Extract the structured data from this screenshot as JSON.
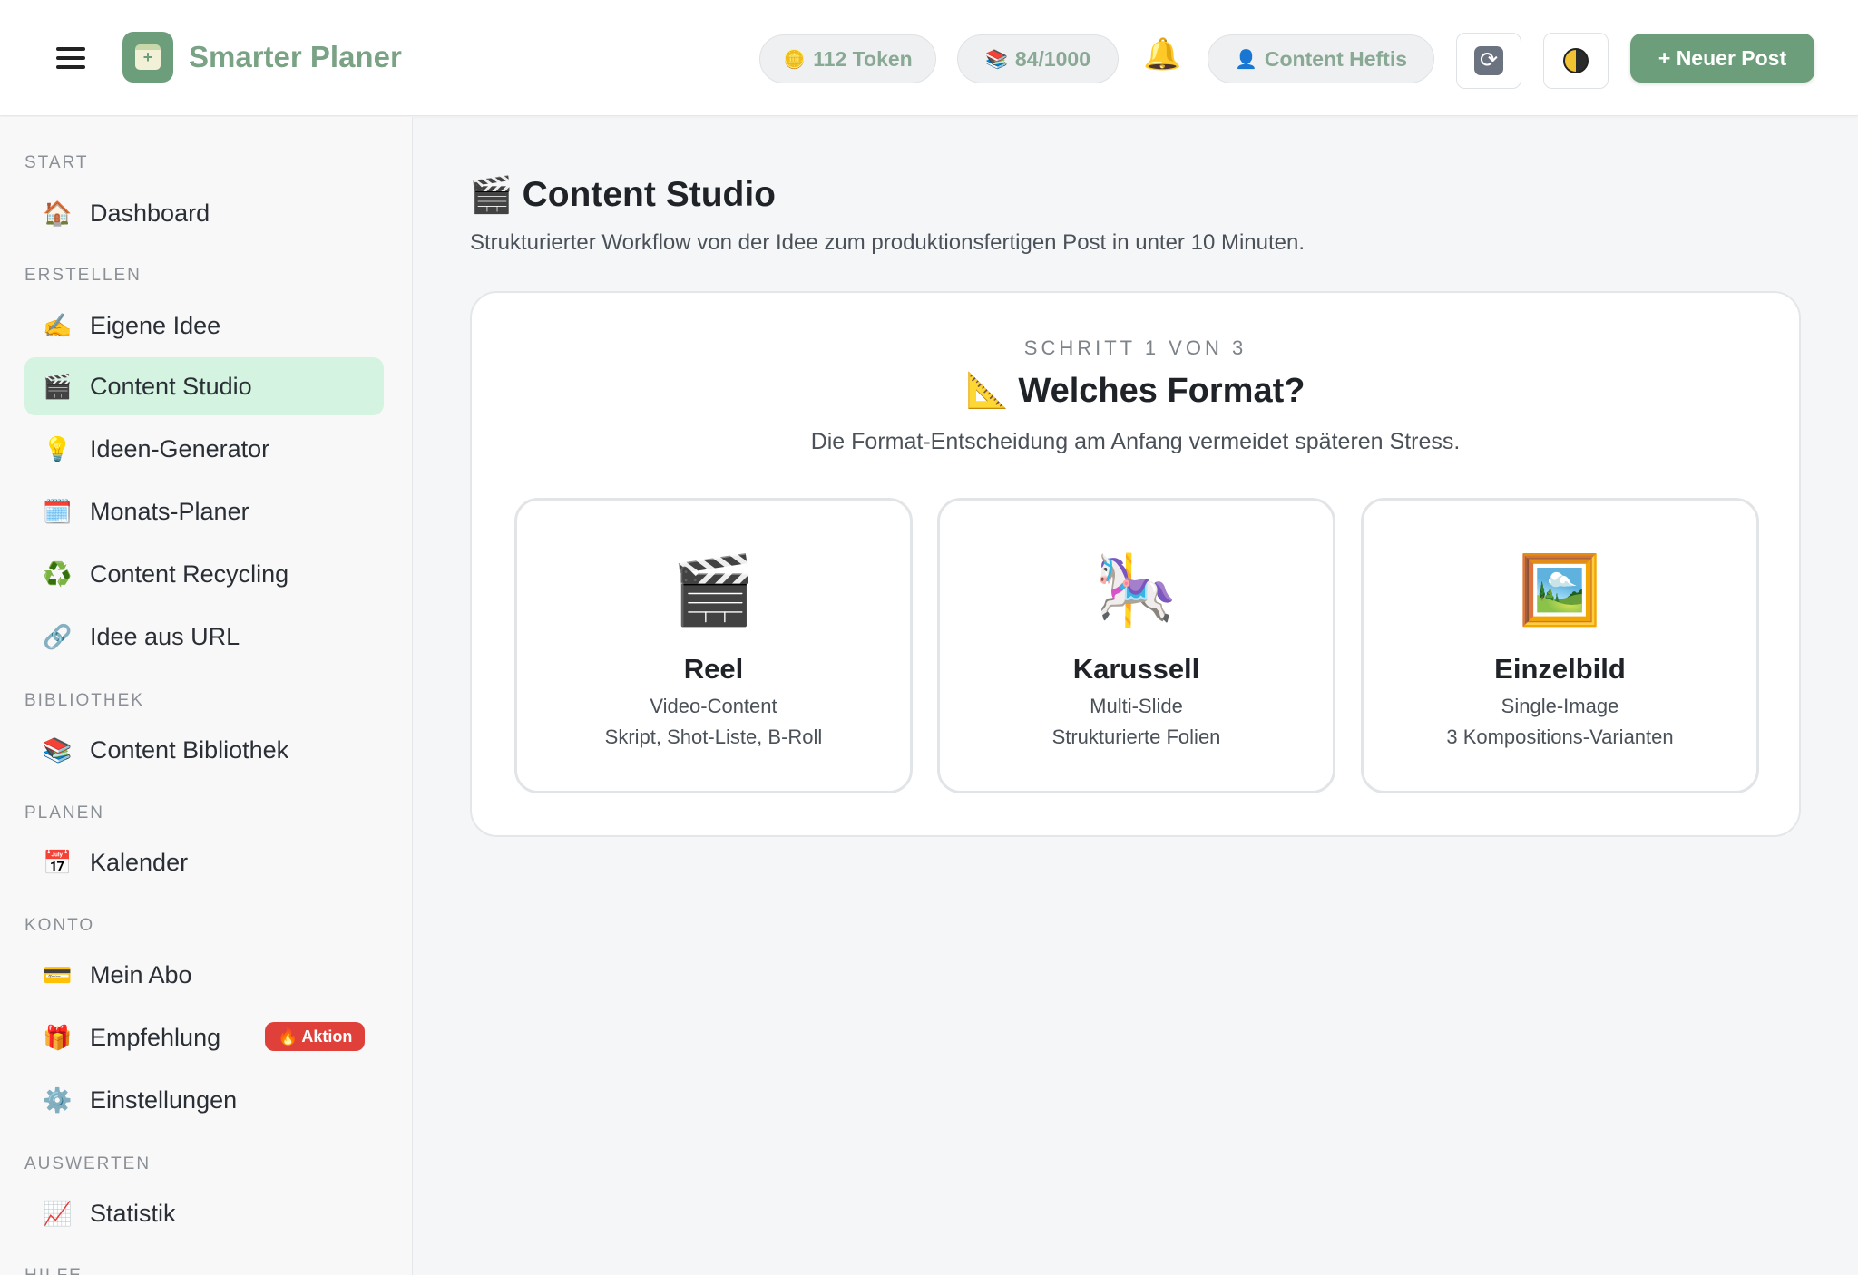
{
  "header": {
    "app_name": "Smarter Planer",
    "token_label": "112 Token",
    "quota_label": "84/1000",
    "user_label": "Content Heftis",
    "new_post_label": "+ Neuer Post",
    "icons": [
      "menu-icon",
      "logo-icon",
      "coin-icon",
      "books-icon",
      "bell-icon",
      "user-icon",
      "refresh-icon",
      "theme-moon-icon"
    ]
  },
  "sidebar": {
    "sections": [
      {
        "title": "START",
        "items": [
          {
            "label": "Dashboard",
            "icon": "🏠"
          }
        ]
      },
      {
        "title": "ERSTELLEN",
        "items": [
          {
            "label": "Eigene Idee",
            "icon": "✍️"
          },
          {
            "label": "Content Studio",
            "icon": "🎬",
            "active": true
          },
          {
            "label": "Ideen-Generator",
            "icon": "💡"
          },
          {
            "label": "Monats-Planer",
            "icon": "🗓️"
          },
          {
            "label": "Content Recycling",
            "icon": "♻️"
          },
          {
            "label": "Idee aus URL",
            "icon": "🔗"
          }
        ]
      },
      {
        "title": "BIBLIOTHEK",
        "items": [
          {
            "label": "Content Bibliothek",
            "icon": "📚"
          }
        ]
      },
      {
        "title": "PLANEN",
        "items": [
          {
            "label": "Kalender",
            "icon": "📅"
          }
        ]
      },
      {
        "title": "KONTO",
        "items": [
          {
            "label": "Mein Abo",
            "icon": "💳"
          },
          {
            "label": "Empfehlung",
            "icon": "🎁",
            "badge": "Aktion",
            "badge_icon": "🔥"
          },
          {
            "label": "Einstellungen",
            "icon": "⚙️"
          }
        ]
      },
      {
        "title": "AUSWERTEN",
        "items": [
          {
            "label": "Statistik",
            "icon": "📈"
          }
        ]
      },
      {
        "title": "HILFE",
        "items": []
      }
    ],
    "active_color": "#d4f3e0",
    "badge_color": "#e0403a"
  },
  "main": {
    "title": "Content Studio",
    "title_icon": "🎬",
    "subtitle": "Strukturierter Workflow von der Idee zum produktionsfertigen Post in unter 10 Minuten.",
    "step_label": "SCHRITT 1 VON 3",
    "question": "Welches Format?",
    "question_icon": "📐",
    "question_sub": "Die Format-Entscheidung am Anfang vermeidet späteren Stress.",
    "formats": [
      {
        "name": "Reel",
        "icon": "🎬",
        "line1": "Video-Content",
        "line2": "Skript, Shot-Liste, B-Roll"
      },
      {
        "name": "Karussell",
        "icon": "🎠",
        "line1": "Multi-Slide",
        "line2": "Strukturierte Folien"
      },
      {
        "name": "Einzelbild",
        "icon": "🖼️",
        "line1": "Single-Image",
        "line2": "3 Kompositions-Varianten"
      }
    ]
  },
  "colors": {
    "brand": "#6d9e7b",
    "brand_text": "#7aa385"
  }
}
